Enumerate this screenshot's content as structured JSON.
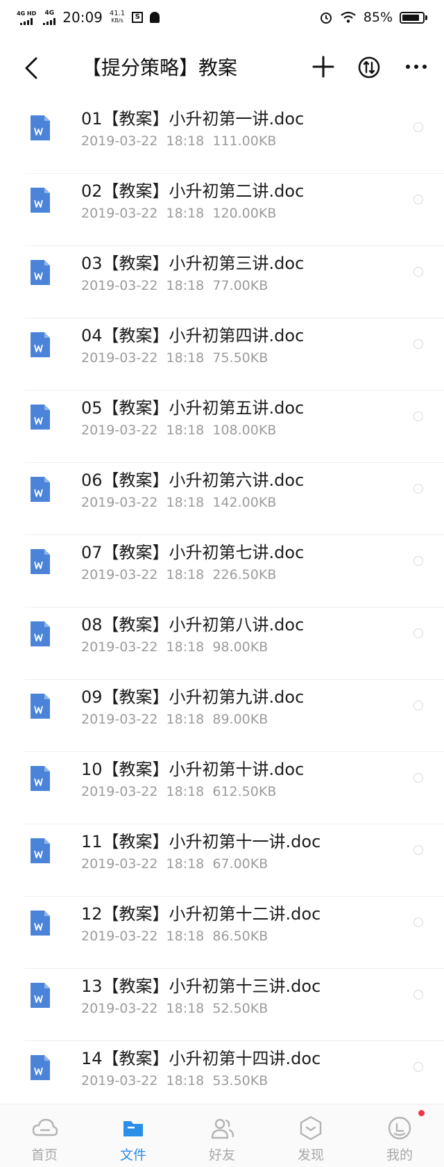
{
  "status_bar": {
    "signal1": "4G HD",
    "signal2": "4G",
    "time": "20:09",
    "net_speed_value": "41.1",
    "net_speed_unit": "KB/s",
    "battery": "85%",
    "battery_level": 0.85
  },
  "header": {
    "title": "【提分策略】教案"
  },
  "files": [
    {
      "name": "01【教案】小升初第一讲.doc",
      "date": "2019-03-22",
      "time": "18:18",
      "size": "111.00KB"
    },
    {
      "name": "02【教案】小升初第二讲.doc",
      "date": "2019-03-22",
      "time": "18:18",
      "size": "120.00KB"
    },
    {
      "name": "03【教案】小升初第三讲.doc",
      "date": "2019-03-22",
      "time": "18:18",
      "size": "77.00KB"
    },
    {
      "name": "04【教案】小升初第四讲.doc",
      "date": "2019-03-22",
      "time": "18:18",
      "size": "75.50KB"
    },
    {
      "name": "05【教案】小升初第五讲.doc",
      "date": "2019-03-22",
      "time": "18:18",
      "size": "108.00KB"
    },
    {
      "name": "06【教案】小升初第六讲.doc",
      "date": "2019-03-22",
      "time": "18:18",
      "size": "142.00KB"
    },
    {
      "name": "07【教案】小升初第七讲.doc",
      "date": "2019-03-22",
      "time": "18:18",
      "size": "226.50KB"
    },
    {
      "name": "08【教案】小升初第八讲.doc",
      "date": "2019-03-22",
      "time": "18:18",
      "size": "98.00KB"
    },
    {
      "name": "09【教案】小升初第九讲.doc",
      "date": "2019-03-22",
      "time": "18:18",
      "size": "89.00KB"
    },
    {
      "name": "10【教案】小升初第十讲.doc",
      "date": "2019-03-22",
      "time": "18:18",
      "size": "612.50KB"
    },
    {
      "name": "11【教案】小升初第十一讲.doc",
      "date": "2019-03-22",
      "time": "18:18",
      "size": "67.00KB"
    },
    {
      "name": "12【教案】小升初第十二讲.doc",
      "date": "2019-03-22",
      "time": "18:18",
      "size": "86.50KB"
    },
    {
      "name": "13【教案】小升初第十三讲.doc",
      "date": "2019-03-22",
      "time": "18:18",
      "size": "52.50KB"
    },
    {
      "name": "14【教案】小升初第十四讲.doc",
      "date": "2019-03-22",
      "time": "18:18",
      "size": "53.50KB"
    }
  ],
  "bottom_nav": [
    {
      "label": "首页",
      "icon": "home-cloud-icon",
      "active": false
    },
    {
      "label": "文件",
      "icon": "folder-icon",
      "active": true
    },
    {
      "label": "好友",
      "icon": "friends-icon",
      "active": false
    },
    {
      "label": "发现",
      "icon": "discover-icon",
      "active": false
    },
    {
      "label": "我的",
      "icon": "profile-icon",
      "active": false,
      "badge": true
    }
  ],
  "colors": {
    "accent": "#2b8fe8",
    "doc_icon": "#4a83d8",
    "badge": "#f0354a"
  }
}
